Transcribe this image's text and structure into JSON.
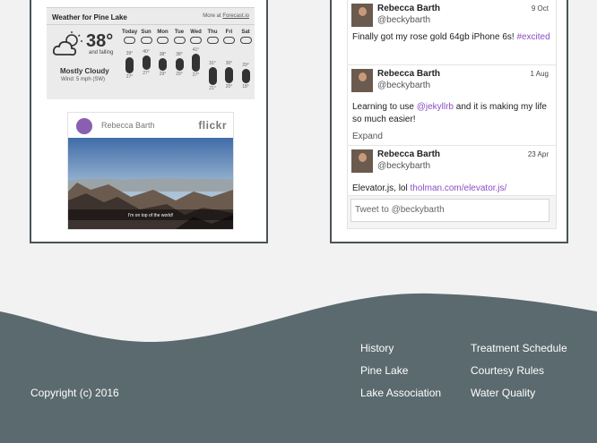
{
  "weather": {
    "title": "Weather for Pine Lake",
    "more_prefix": "More at ",
    "more_link": "Forecast.io",
    "temperature": "38°",
    "trend": "and falling",
    "summary": "Mostly Cloudy",
    "wind": "Wind: 5 mph (SW)",
    "days": [
      {
        "name": "Today",
        "high": "39°",
        "low": "27°",
        "icon": "cloud-icon"
      },
      {
        "name": "Sun",
        "high": "40°",
        "low": "27°",
        "icon": "cloud-icon"
      },
      {
        "name": "Mon",
        "high": "38°",
        "low": "29°",
        "icon": "cloud-icon"
      },
      {
        "name": "Tue",
        "high": "38°",
        "low": "29°",
        "icon": "cloud-icon"
      },
      {
        "name": "Wed",
        "high": "41°",
        "low": "27°",
        "icon": "cloud-icon"
      },
      {
        "name": "Thu",
        "high": "31°",
        "low": "21°",
        "icon": "cloud-icon"
      },
      {
        "name": "Fri",
        "high": "30°",
        "low": "20°",
        "icon": "cloud-icon"
      },
      {
        "name": "Sat",
        "high": "29°",
        "low": "18°",
        "icon": "cloud-icon"
      }
    ]
  },
  "flickr": {
    "user": "Rebecca Barth",
    "logo": "flickr",
    "caption": "I'm on top of the world!"
  },
  "tweets": {
    "items": [
      {
        "name": "Rebecca Barth",
        "handle": "@beckybarth",
        "date": "9 Oct",
        "text": "Finally got my rose gold 64gb iPhone 6s! ",
        "link": "#excited",
        "text_after": ""
      },
      {
        "name": "Rebecca Barth",
        "handle": "@beckybarth",
        "date": "1 Aug",
        "text": "Learning to use ",
        "link": "@jekyllrb",
        "text_after": " and it is making my life so much easier!",
        "expand": "Expand"
      },
      {
        "name": "Rebecca Barth",
        "handle": "@beckybarth",
        "date": "23 Apr",
        "text": "Elevator.js, lol ",
        "link": "tholman.com/elevator.js/",
        "text_after": ""
      }
    ],
    "compose_placeholder": "Tweet to @beckybarth"
  },
  "footer": {
    "copyright": "Copyright (c) 2016",
    "links_col1": [
      "History",
      "Pine Lake",
      "Lake Association"
    ],
    "links_col2": [
      "Treatment Schedule",
      "Courtesy Rules",
      "Water Quality"
    ],
    "bg_color": "#5b6a6e"
  }
}
